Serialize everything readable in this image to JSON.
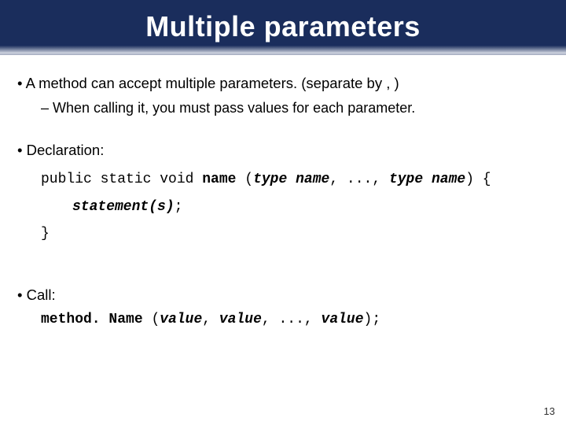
{
  "title": "Multiple parameters",
  "bullet1": "A method can accept multiple parameters. (separate by , )",
  "sub1": "When calling it, you must pass values for each parameter.",
  "bullet2": "Declaration:",
  "decl": {
    "prefix": "public static void ",
    "name": "name",
    "open": " (",
    "type1": "type",
    "sp": " ",
    "name1": "name",
    "comma": ", ",
    "dots": "..., ",
    "type2": "type",
    "name2": "name",
    "close": ")",
    "brace": " {"
  },
  "stmt": "statement(s)",
  "semi": ";",
  "closebrace": "}",
  "bullet3": "Call:",
  "call": {
    "method": "method. Name ",
    "open": "(",
    "value": "value",
    "comma": ", ",
    "dots": "..., ",
    "close": ")",
    "semi": ";"
  },
  "page": "13"
}
